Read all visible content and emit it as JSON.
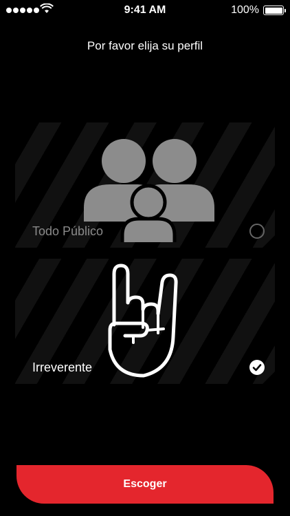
{
  "status_bar": {
    "time": "9:41 AM",
    "battery_text": "100%",
    "icons": [
      "signal-icon",
      "wifi-icon",
      "battery-icon"
    ]
  },
  "page": {
    "title": "Por favor elija su perfil"
  },
  "options": [
    {
      "label": "Todo Público",
      "icon": "family-icon",
      "selected": false
    },
    {
      "label": "Irreverente",
      "icon": "rock-hand-icon",
      "selected": true
    }
  ],
  "cta": {
    "label": "Escoger"
  },
  "colors": {
    "background": "#000000",
    "accent": "#e4262d",
    "icon_gray": "#8c8c8c",
    "text": "#ffffff"
  }
}
